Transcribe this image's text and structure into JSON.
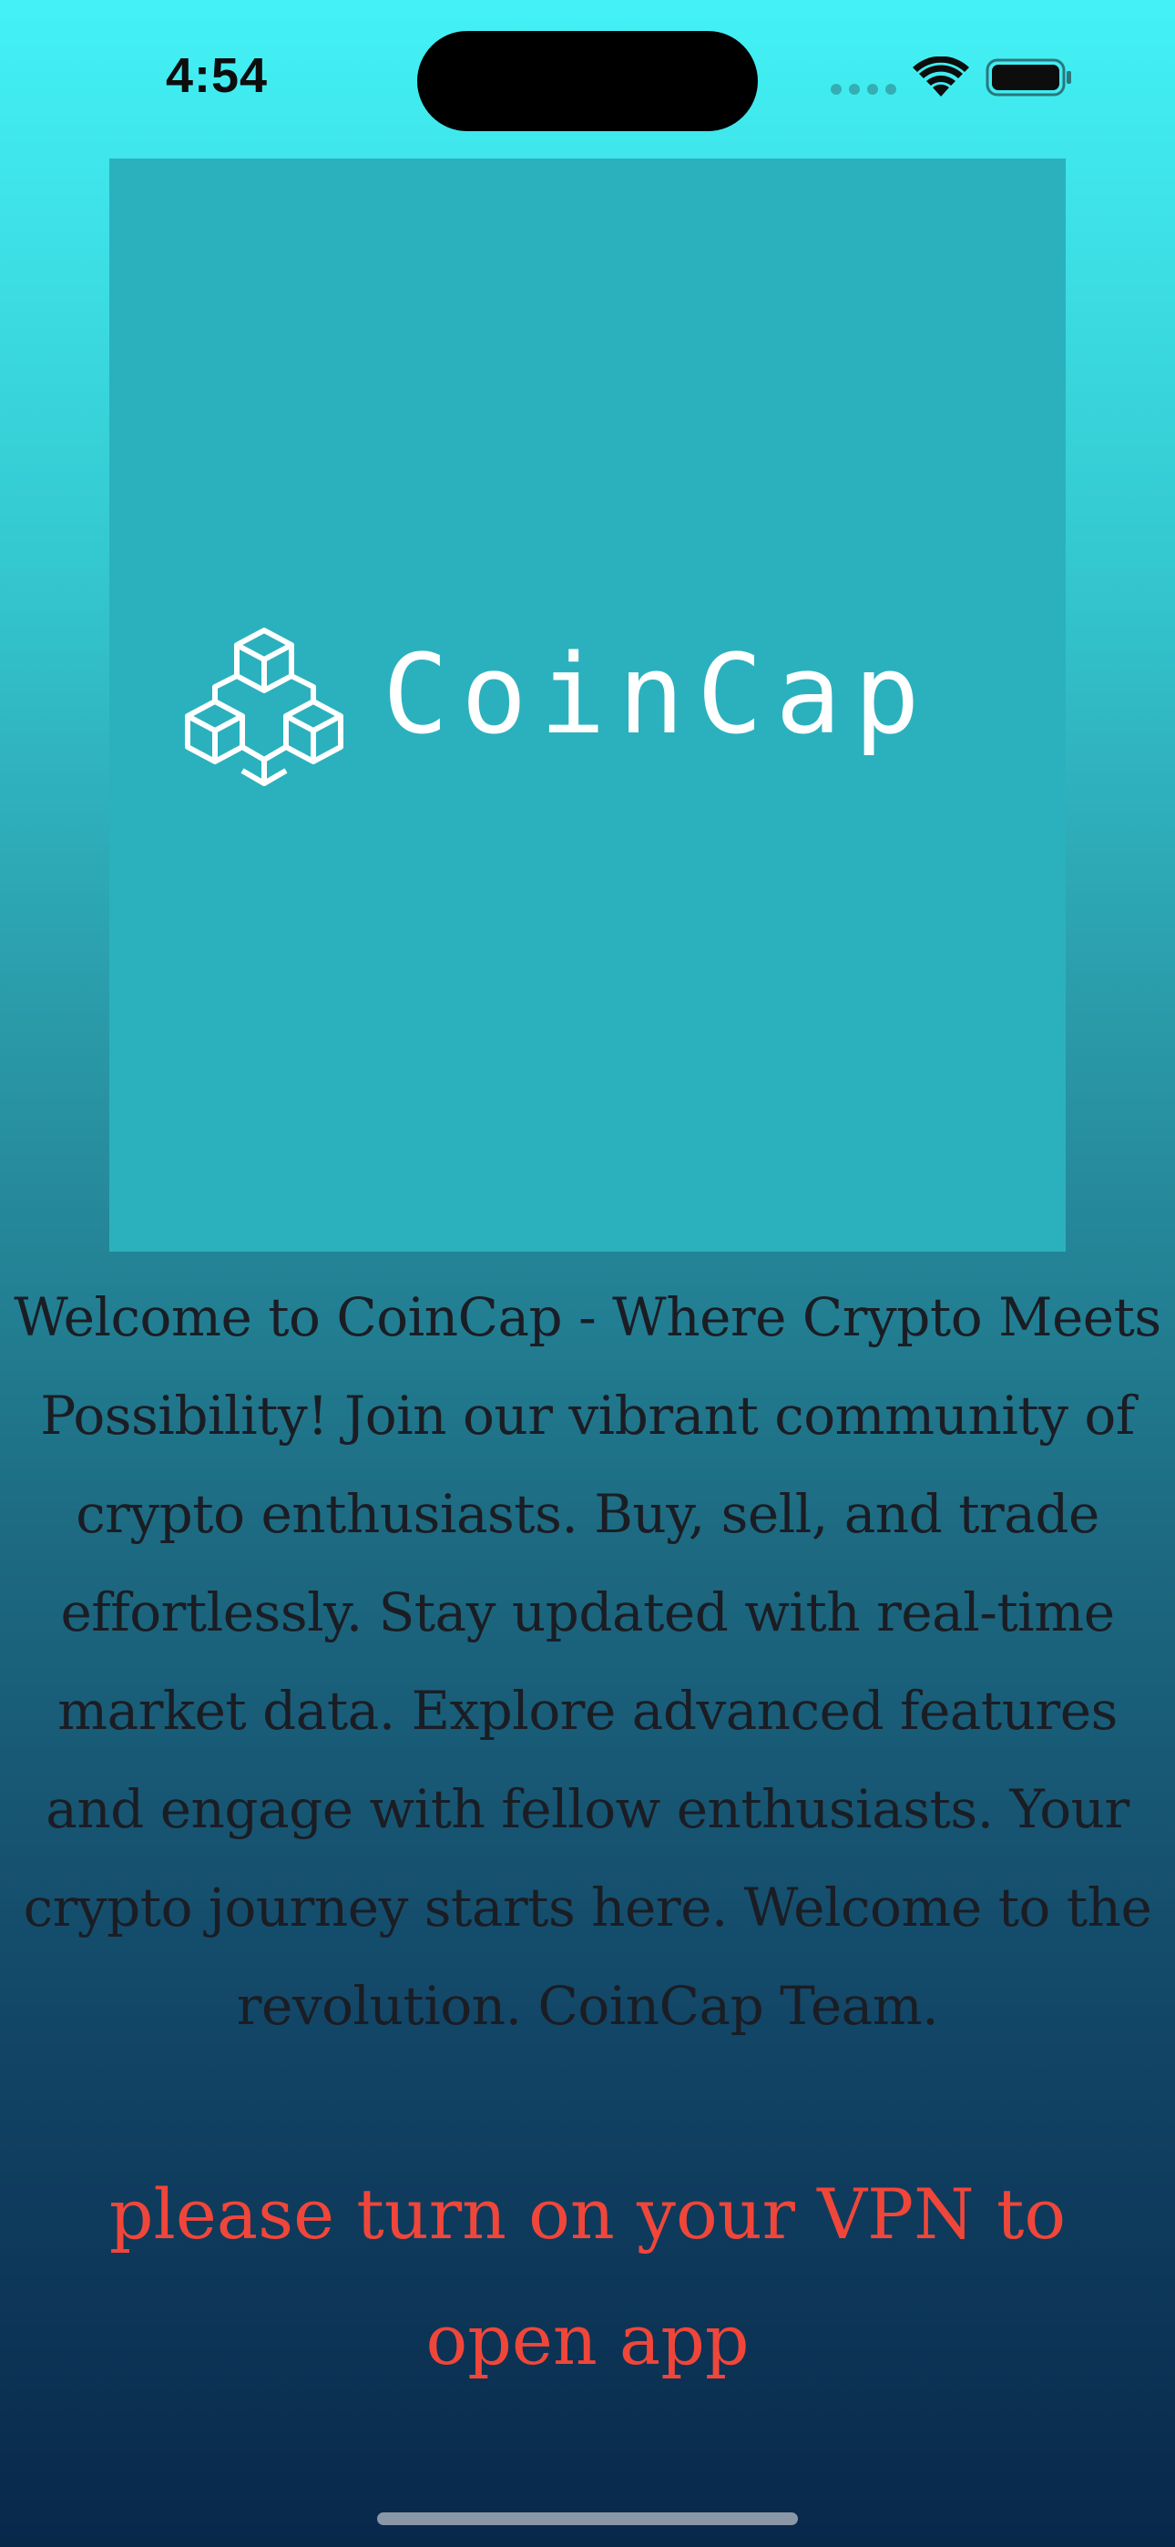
{
  "status_bar": {
    "time": "4:54",
    "icons": [
      "signal-icon",
      "wifi-icon",
      "battery-icon"
    ]
  },
  "logo": {
    "icon": "cubes-logo-icon",
    "text": "CoinCap"
  },
  "welcome_message": "Welcome to CoinCap - Where Crypto Meets Possibility! Join our vibrant community of crypto enthusiasts. Buy, sell, and trade effortlessly. Stay updated with real-time market data. Explore advanced features and engage with fellow enthusiasts. Your crypto journey starts here. Welcome to the revolution. CoinCap Team.",
  "vpn_warning": "please turn on your VPN to open app",
  "colors": {
    "background_top": "#43f2f6",
    "background_bottom": "#08284a",
    "logo_panel": "#2bb1bd",
    "body_text": "#1b1d24",
    "warning_text": "#f0463a"
  }
}
